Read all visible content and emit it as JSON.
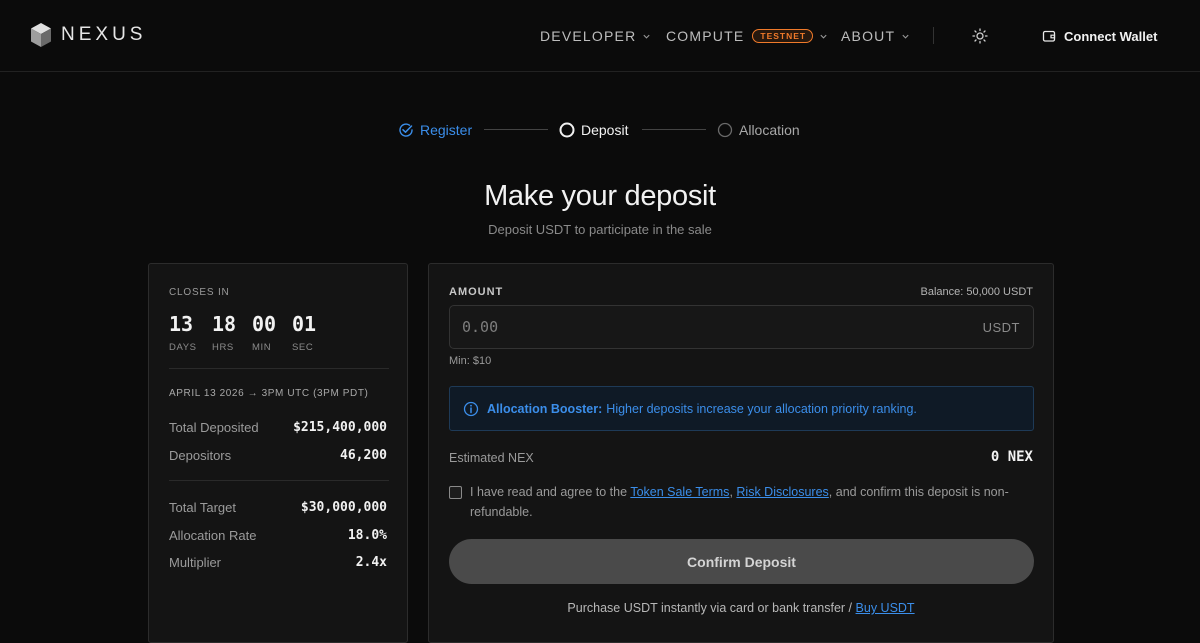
{
  "header": {
    "logo_text": "NEXUS",
    "nav": [
      {
        "label": "DEVELOPER"
      },
      {
        "label": "COMPUTE",
        "badge": "TESTNET"
      },
      {
        "label": "ABOUT"
      }
    ],
    "wallet_label": "Connect Wallet"
  },
  "stepper": {
    "steps": [
      {
        "label": "Register",
        "state": "done"
      },
      {
        "label": "Deposit",
        "state": "current"
      },
      {
        "label": "Allocation",
        "state": "pending"
      }
    ]
  },
  "page": {
    "title": "Make your deposit",
    "subtitle": "Deposit USDT to participate in the sale"
  },
  "sale": {
    "closes_label": "CLOSES IN",
    "countdown": [
      {
        "value": "13",
        "unit": "DAYS"
      },
      {
        "value": "18",
        "unit": "HRS"
      },
      {
        "value": "00",
        "unit": "MIN"
      },
      {
        "value": "01",
        "unit": "SEC"
      }
    ],
    "date_line": "APRIL 13 2026 → 3PM UTC (3PM PDT)",
    "stats": [
      {
        "label": "Total Deposited",
        "value": "$215,400,000"
      },
      {
        "label": "Depositors",
        "value": "46,200"
      },
      {
        "label": "Total Target",
        "value": "$30,000,000"
      },
      {
        "label": "Allocation Rate",
        "value": "18.0%"
      },
      {
        "label": "Multiplier",
        "value": "2.4x"
      }
    ]
  },
  "deposit": {
    "amount_label": "AMOUNT",
    "balance": "Balance: 50,000 USDT",
    "amount_value": "",
    "amount_placeholder": "0.00",
    "unit": "USDT",
    "min_note": "Min: $10",
    "booster_title": "Allocation Booster:",
    "booster_text": "Higher deposits increase your allocation priority ranking.",
    "estimated_label": "Estimated NEX",
    "estimated_value": "0 NEX",
    "agree_prefix": "I have read and agree to the",
    "agree_link1": "Token Sale Terms",
    "agree_comma": ",",
    "agree_link2": "Risk Disclosures",
    "agree_suffix": ", and confirm this deposit is non-refundable.",
    "agree_checked": false,
    "confirm_label": "Confirm Deposit",
    "buy_prefix": "Purchase USDT instantly via card or bank transfer /",
    "buy_link": "Buy USDT"
  },
  "colors": {
    "accent": "#3b8eea",
    "testnet_badge": "#f07a2a",
    "background": "#0b0b0b",
    "card": "#141414"
  },
  "icons": {
    "logo": "cube-logo-icon",
    "chevron": "chevron-down-icon",
    "theme": "sun-icon",
    "wallet": "wallet-icon",
    "step_done": "check-circle-icon",
    "step_current": "circle-icon",
    "info": "info-icon"
  }
}
